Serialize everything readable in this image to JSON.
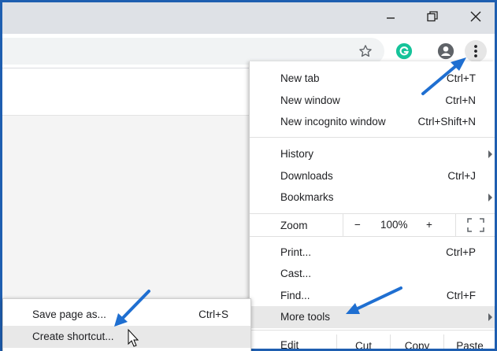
{
  "window": {
    "controls": [
      {
        "name": "minimize-button",
        "icon": "minimize-icon"
      },
      {
        "name": "restore-button",
        "icon": "restore-icon"
      },
      {
        "name": "close-button",
        "icon": "close-icon"
      }
    ]
  },
  "toolbar": {
    "icons": [
      "star-icon",
      "grammarly-icon",
      "profile-icon",
      "more-vertical-icon"
    ],
    "grammarly_color": "#15c39a"
  },
  "menu": {
    "new_tab": {
      "label": "New tab",
      "shortcut": "Ctrl+T"
    },
    "new_window": {
      "label": "New window",
      "shortcut": "Ctrl+N"
    },
    "new_incognito": {
      "label": "New incognito window",
      "shortcut": "Ctrl+Shift+N"
    },
    "history": {
      "label": "History"
    },
    "downloads": {
      "label": "Downloads",
      "shortcut": "Ctrl+J"
    },
    "bookmarks": {
      "label": "Bookmarks"
    },
    "zoom": {
      "label": "Zoom",
      "minus": "−",
      "value": "100%",
      "plus": "+"
    },
    "print": {
      "label": "Print...",
      "shortcut": "Ctrl+P"
    },
    "cast": {
      "label": "Cast..."
    },
    "find": {
      "label": "Find...",
      "shortcut": "Ctrl+F"
    },
    "more_tools": {
      "label": "More tools"
    },
    "edit": {
      "label": "Edit",
      "cut": "Cut",
      "copy": "Copy",
      "paste": "Paste"
    }
  },
  "submenu": {
    "save_page": {
      "label": "Save page as...",
      "shortcut": "Ctrl+S"
    },
    "create_shortcut": {
      "label": "Create shortcut..."
    }
  },
  "annotations": {
    "arrow_color": "#1f6fd1"
  }
}
